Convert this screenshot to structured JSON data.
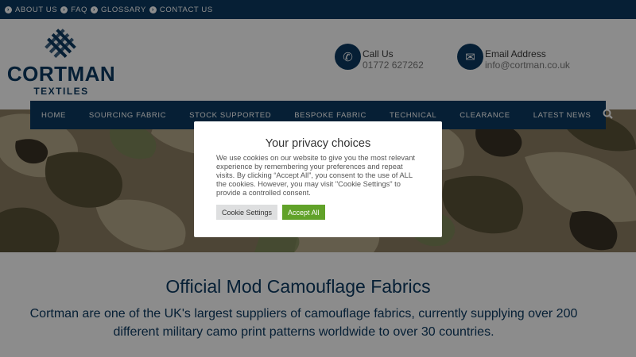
{
  "topbar": {
    "links": [
      "ABOUT US",
      "FAQ",
      "GLOSSARY",
      "CONTACT US"
    ]
  },
  "logo": {
    "name": "CORTMAN",
    "sub": "TEXTILES"
  },
  "contact": {
    "call_label": "Call Us",
    "call_value": "01772 627262",
    "email_label": "Email Address",
    "email_value": "info@cortman.co.uk"
  },
  "nav": {
    "items": [
      "HOME",
      "SOURCING FABRIC",
      "STOCK SUPPORTED",
      "BESPOKE FABRIC",
      "TECHNICAL",
      "CLEARANCE",
      "LATEST NEWS"
    ]
  },
  "content": {
    "heading": "Official Mod Camouflage Fabrics",
    "text": "Cortman are one of the UK's largest suppliers of camouflage fabrics, currently supplying over 200 different military camo print patterns worldwide to over 30 countries."
  },
  "cookie": {
    "title": "Your privacy choices",
    "body": "We use cookies on our website to give you the most relevant experience by remembering your preferences and repeat visits. By clicking “Accept All”, you consent to the use of ALL the cookies. However, you may visit \"Cookie Settings\" to provide a controlled consent.",
    "settings_label": "Cookie Settings",
    "accept_label": "Accept All"
  },
  "colors": {
    "brand": "#0b3a61",
    "accept": "#61a229"
  },
  "icons": [
    "arrow-circle-icon",
    "logo-mark-icon",
    "phone-icon",
    "envelope-icon",
    "search-icon"
  ]
}
